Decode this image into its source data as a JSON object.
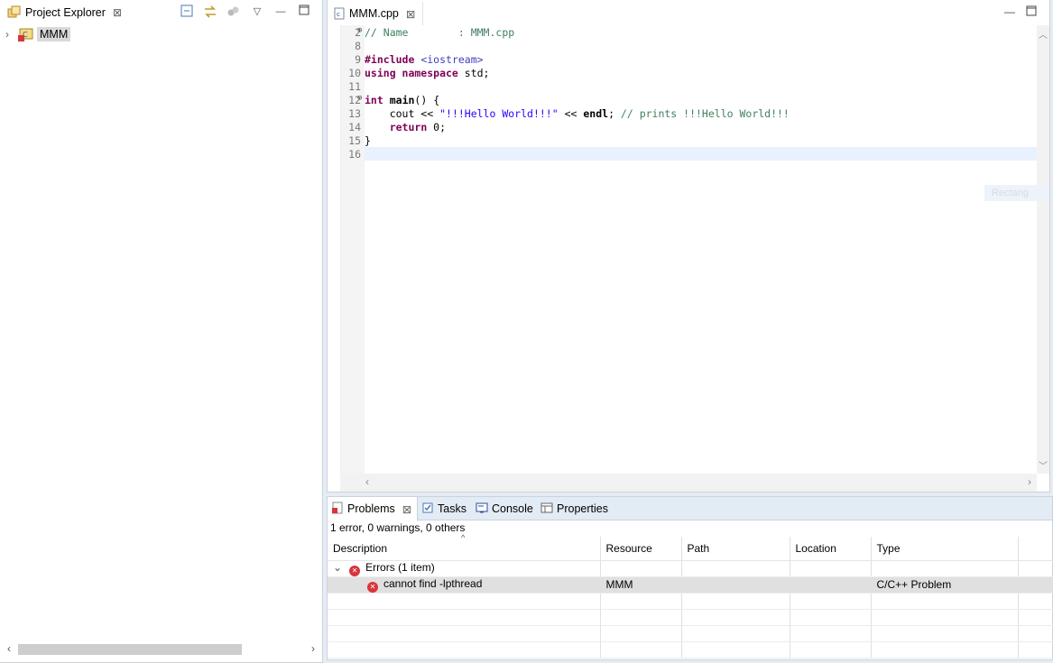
{
  "project_explorer": {
    "tab_label": "Project Explorer",
    "project_name": "MMM"
  },
  "editor": {
    "tab_label": "MMM.cpp",
    "lines": [
      {
        "num": "2",
        "text": "// Name        : MMM.cpp"
      },
      {
        "num": "8",
        "text": ""
      },
      {
        "num": "9",
        "text": "#include <iostream>"
      },
      {
        "num": "10",
        "text": "using namespace std;"
      },
      {
        "num": "11",
        "text": ""
      },
      {
        "num": "12",
        "text": "int main() {"
      },
      {
        "num": "13",
        "text": "    cout << \"!!!Hello World!!!\" << endl; // prints !!!Hello World!!!"
      },
      {
        "num": "14",
        "text": "    return 0;"
      },
      {
        "num": "15",
        "text": "}"
      },
      {
        "num": "16",
        "text": ""
      }
    ],
    "ghost_text": "Rectang"
  },
  "bottom_panel": {
    "tabs": [
      "Problems",
      "Tasks",
      "Console",
      "Properties"
    ],
    "summary": "1 error, 0 warnings, 0 others",
    "columns": [
      "Description",
      "Resource",
      "Path",
      "Location",
      "Type"
    ],
    "group_label": "Errors (1 item)",
    "rows": [
      {
        "description": "cannot find -lpthread",
        "resource": "MMM",
        "path": "",
        "location": "",
        "type": "C/C++ Problem"
      }
    ]
  },
  "colors": {
    "accent": "#e7ecf3",
    "error": "#d9333c",
    "keyword": "#7f0055",
    "comment": "#3f7f5f",
    "string": "#2a00ff"
  }
}
